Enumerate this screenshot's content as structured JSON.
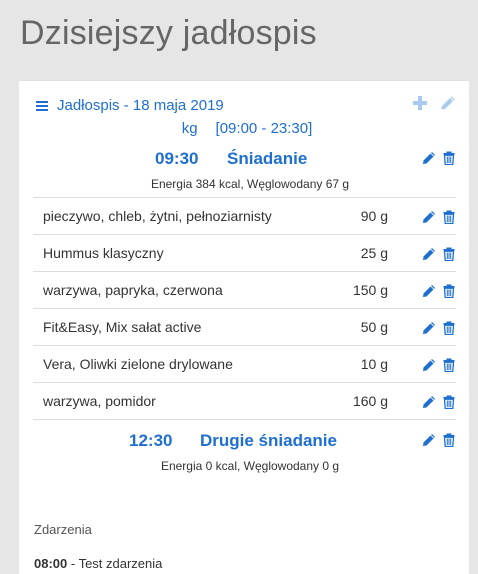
{
  "page": {
    "title": "Dzisiejszy jadłospis"
  },
  "menu": {
    "title": "Jadłospis - 18 maja 2019",
    "unit": "kg",
    "time_range": "[09:00 - 23:30]"
  },
  "meals": [
    {
      "time": "09:30",
      "name": "Śniadanie",
      "summary": "Energia 384 kcal,   Węglowodany 67 g",
      "items": [
        {
          "name": "pieczywo, chleb, żytni, pełnoziarnisty",
          "qty": "90 g"
        },
        {
          "name": "Hummus klasyczny",
          "qty": "25 g"
        },
        {
          "name": "warzywa, papryka, czerwona",
          "qty": "150 g"
        },
        {
          "name": "Fit&Easy, Mix sałat active",
          "qty": "50 g"
        },
        {
          "name": "Vera, Oliwki zielone drylowane",
          "qty": "10 g"
        },
        {
          "name": "warzywa, pomidor",
          "qty": "160 g"
        }
      ]
    },
    {
      "time": "12:30",
      "name": "Drugie śniadanie",
      "summary": "Energia 0 kcal,   Węglowodany 0 g",
      "items": []
    }
  ],
  "events": {
    "label": "Zdarzenia",
    "items": [
      {
        "time": "08:00",
        "text": " - Test zdarzenia"
      }
    ]
  },
  "colors": {
    "accent": "#1e6fd0",
    "icon_muted": "#a9c9ee",
    "background": "#e6e6e6"
  },
  "icons": {
    "menu": "hamburger-icon",
    "add": "plus-icon",
    "edit": "pencil-icon",
    "delete": "trash-icon"
  }
}
